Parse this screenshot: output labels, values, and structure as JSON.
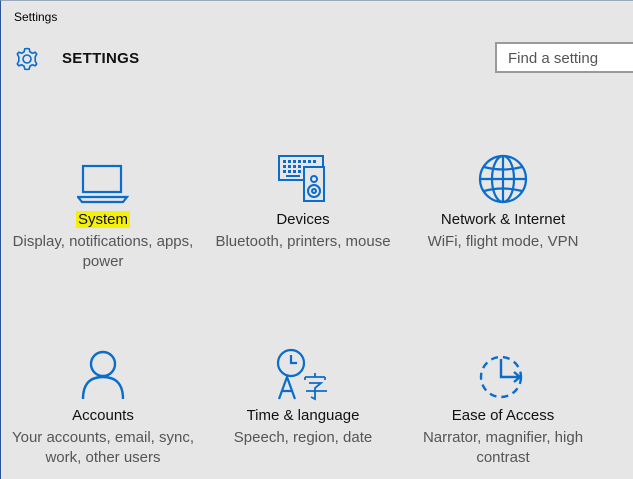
{
  "window": {
    "title": "Settings"
  },
  "header": {
    "label": "SETTINGS",
    "icon": "gear-icon"
  },
  "search": {
    "placeholder": "Find a setting"
  },
  "accent": "#0a6ccb",
  "highlight": "#f5f00a",
  "tiles": [
    {
      "title": "System",
      "description": "Display, notifications, apps, power",
      "icon": "laptop-icon",
      "highlighted": true
    },
    {
      "title": "Devices",
      "description": "Bluetooth, printers, mouse",
      "icon": "devices-icon"
    },
    {
      "title": "Network & Internet",
      "description": "WiFi, flight mode, VPN",
      "icon": "globe-icon"
    },
    {
      "title": "Accounts",
      "description": "Your accounts, email, sync, work, other users",
      "icon": "person-icon"
    },
    {
      "title": "Time & language",
      "description": "Speech, region, date",
      "icon": "time-language-icon"
    },
    {
      "title": "Ease of Access",
      "description": "Narrator, magnifier, high contrast",
      "icon": "ease-of-access-icon"
    }
  ]
}
